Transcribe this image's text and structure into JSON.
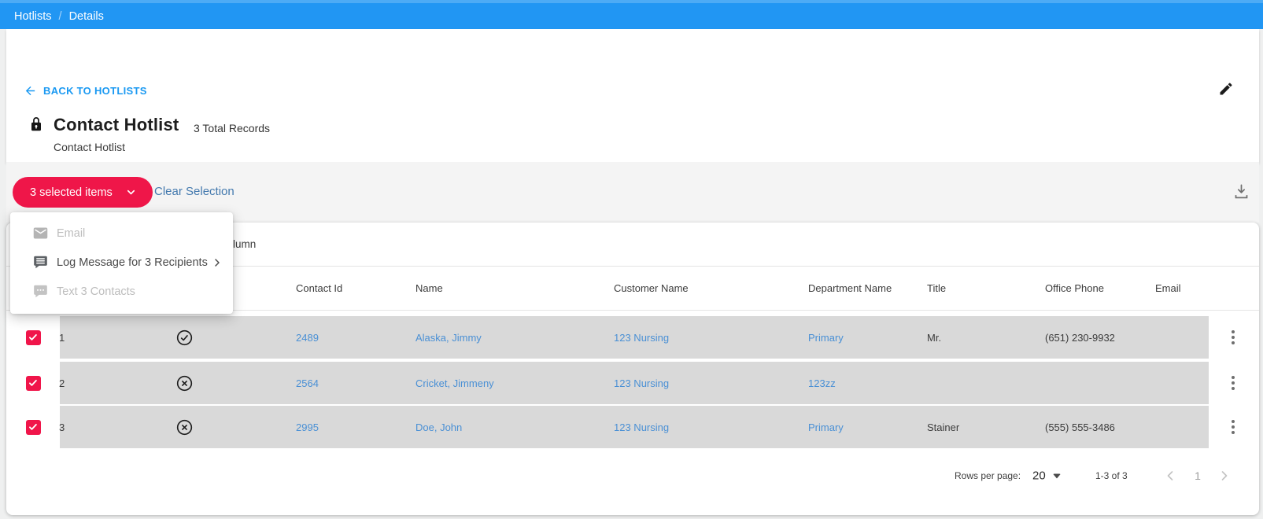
{
  "topbar": {
    "breadcrumb": [
      "Hotlists",
      "Details"
    ],
    "separator": "/"
  },
  "header": {
    "back_label": "BACK TO HOTLISTS",
    "title": "Contact Hotlist",
    "total_records": "3 Total Records",
    "subtitle": "Contact Hotlist"
  },
  "toolbar": {
    "selected_button_label": "3 selected items",
    "clear_selection_label": "Clear Selection",
    "download_icon": "download-icon"
  },
  "menu": {
    "items": [
      {
        "label": "Email",
        "icon": "email-icon",
        "enabled": false
      },
      {
        "label": "Log Message for 3 Recipients",
        "icon": "log-message-icon",
        "enabled": true,
        "has_submenu": true
      },
      {
        "label": "Text 3 Contacts",
        "icon": "sms-icon",
        "enabled": false
      }
    ]
  },
  "table": {
    "toolbar_fragment": "lumn",
    "columns": [
      "Contact Id",
      "Name",
      "Customer Name",
      "Department Name",
      "Title",
      "Office Phone",
      "Email"
    ],
    "rows": [
      {
        "num": "1",
        "status": "check-circle",
        "checked": true,
        "contact_id": "2489",
        "name": "Alaska, Jimmy",
        "customer_name": "123 Nursing",
        "department_name": "Primary",
        "title": "Mr.",
        "office_phone": "(651) 230-9932",
        "email": ""
      },
      {
        "num": "2",
        "status": "x-circle",
        "checked": true,
        "contact_id": "2564",
        "name": "Cricket, Jimmeny",
        "customer_name": "123 Nursing",
        "department_name": "123zz",
        "title": "",
        "office_phone": "",
        "email": ""
      },
      {
        "num": "3",
        "status": "x-circle",
        "checked": true,
        "contact_id": "2995",
        "name": "Doe, John",
        "customer_name": "123 Nursing",
        "department_name": "Primary",
        "title": "Stainer",
        "office_phone": "(555) 555-3486",
        "email": ""
      }
    ]
  },
  "pagination": {
    "rows_per_page_label": "Rows per page:",
    "rows_per_page_value": "20",
    "range_label": "1-3 of 3",
    "page_number": "1"
  },
  "colors": {
    "topbar_blue": "#2196f3",
    "back_link_blue": "#1a99f2",
    "table_link_blue": "#4a90d5",
    "clear_selection_blue": "#4379ae",
    "button_red": "#ef1649",
    "checkbox_red": "#f0154a",
    "selected_row_gray": "#d9d9d9",
    "toolbar_band_gray": "#f4f4f4"
  }
}
